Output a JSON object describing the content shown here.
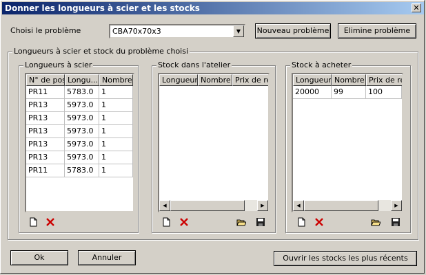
{
  "window": {
    "title": "Donner les longueurs à scier et les stocks",
    "close_label": "✕"
  },
  "problem": {
    "label": "Choisi le problème",
    "selected": "CBA70x70x3",
    "new_button": "Nouveau problème",
    "delete_button": "Elimine problème"
  },
  "main_group": {
    "title": "Longueurs à scier et stock du problème choisi"
  },
  "saw_lengths": {
    "title": "Longueurs à scier",
    "columns": [
      "N° de pos",
      "Longu...",
      "Nombre"
    ],
    "rows": [
      [
        "PR11",
        "5783.0",
        "1"
      ],
      [
        "PR13",
        "5973.0",
        "1"
      ],
      [
        "PR13",
        "5973.0",
        "1"
      ],
      [
        "PR13",
        "5973.0",
        "1"
      ],
      [
        "PR13",
        "5973.0",
        "1"
      ],
      [
        "PR13",
        "5973.0",
        "1"
      ],
      [
        "PR11",
        "5783.0",
        "1"
      ]
    ]
  },
  "workshop_stock": {
    "title": "Stock dans l'atelier",
    "columns": [
      "Longueur",
      "Nombre",
      "Prix de rev"
    ],
    "rows": []
  },
  "buy_stock": {
    "title": "Stock à acheter",
    "columns": [
      "Longueur",
      "Nombre",
      "Prix de rev"
    ],
    "rows": [
      [
        "20000",
        "99",
        "100"
      ]
    ]
  },
  "footer": {
    "ok": "Ok",
    "cancel": "Annuler",
    "open_recent": "Ouvrir les stocks les plus récents"
  },
  "colors": {
    "titlebar_start": "#0a246a",
    "titlebar_end": "#a6caf0",
    "face": "#d4d0c8",
    "delete_red": "#cc0000"
  }
}
